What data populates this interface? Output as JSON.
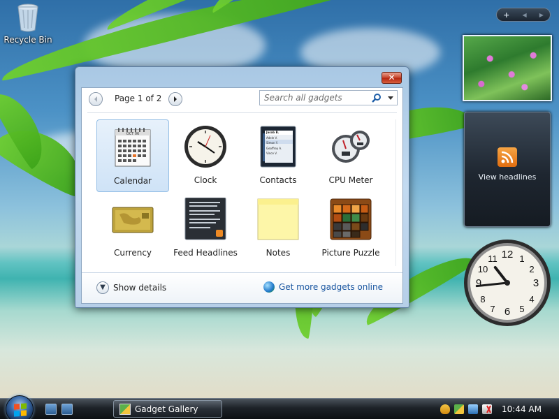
{
  "desktop": {
    "recycle_bin_label": "Recycle Bin"
  },
  "sidebar": {
    "toolbar_add": "+",
    "toolbar_prev": "◀",
    "toolbar_next": "▶",
    "feed_text": "View headlines",
    "clock": {
      "hour": 10,
      "minute": 44
    }
  },
  "gallery": {
    "close_label": "✕",
    "page_label": "Page 1 of 2",
    "search_placeholder": "Search all gadgets",
    "selected": "Calendar",
    "gadgets": [
      {
        "label": "Calendar",
        "icon": "calendar-icon"
      },
      {
        "label": "Clock",
        "icon": "clock-icon"
      },
      {
        "label": "Contacts",
        "icon": "contacts-icon"
      },
      {
        "label": "CPU Meter",
        "icon": "cpu-meter-icon"
      },
      {
        "label": "Currency",
        "icon": "currency-icon"
      },
      {
        "label": "Feed Headlines",
        "icon": "feed-headlines-icon"
      },
      {
        "label": "Notes",
        "icon": "notes-icon"
      },
      {
        "label": "Picture Puzzle",
        "icon": "picture-puzzle-icon"
      }
    ],
    "calendar_icon_text": "OCT 06",
    "contacts_icon_names": [
      "Jacob B.",
      "Adele V.",
      "Simon Y.",
      "Geoffrey A.",
      "Vince V."
    ],
    "show_details": "Show details",
    "get_more": "Get more gadgets online"
  },
  "taskbar": {
    "active_window": "Gadget Gallery",
    "time": "10:44 AM"
  },
  "colors": {
    "accent": "#1a56a0",
    "selection": "#cfe3f7",
    "close": "#c6432a"
  }
}
